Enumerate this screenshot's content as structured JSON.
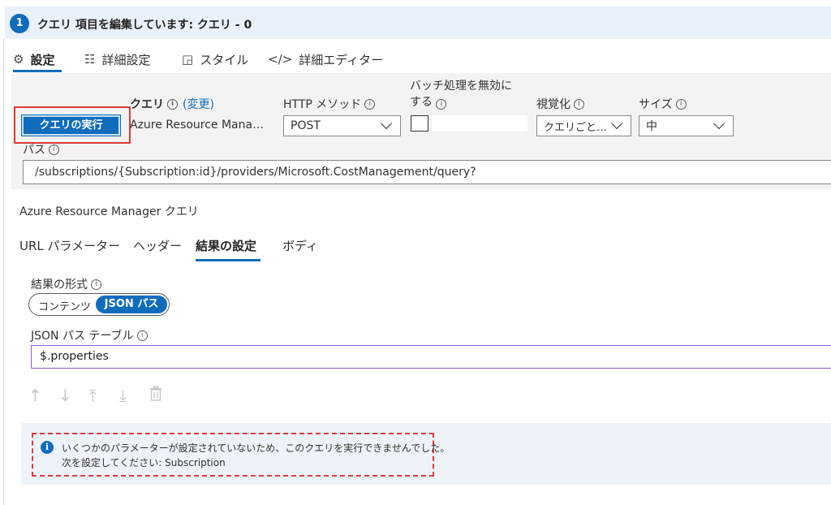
{
  "header": {
    "step": "1",
    "title": "クエリ 項目を編集しています: クエリ - 0"
  },
  "tabs": [
    {
      "label": "設定",
      "icon": "gear-icon"
    },
    {
      "label": "詳細設定",
      "icon": "sliders-icon"
    },
    {
      "label": "スタイル",
      "icon": "style-icon"
    },
    {
      "label": "詳細エディター",
      "icon": "code-icon"
    }
  ],
  "settings": {
    "run_button": "クエリの実行",
    "query_label": "クエリ",
    "query_change": "(変更)",
    "query_value": "Azure Resource Mana…",
    "http_label": "HTTP メソッド",
    "http_value": "POST",
    "batch_label": "バッチ処理を無効にする",
    "batch_checked": false,
    "viz_label": "視覚化",
    "viz_value": "クエリごと…",
    "size_label": "サイズ",
    "size_value": "中",
    "path_label": "パス",
    "path_value": "/subscriptions/{Subscription:id}/providers/Microsoft.CostManagement/query?"
  },
  "arm": {
    "title": "Azure Resource Manager クエリ",
    "subtabs": [
      "URL パラメーター",
      "ヘッダー",
      "結果の設定",
      "ボディ"
    ],
    "active_subtab": "結果の設定"
  },
  "result": {
    "format_label": "結果の形式",
    "format_options": [
      "コンテンツ",
      "JSON パス"
    ],
    "format_selected": "JSON パス",
    "json_table_label": "JSON パス テーブル",
    "json_table_value": "$.properties"
  },
  "message": {
    "line1": "いくつかのパラメーターが設定されていないため、このクエリを実行できませんでした。",
    "line2": "次を設定してください: Subscription"
  },
  "colors": {
    "accent": "#0f6cbd",
    "highlight": "#e03a3a",
    "header_bg": "#e9f2fb"
  }
}
